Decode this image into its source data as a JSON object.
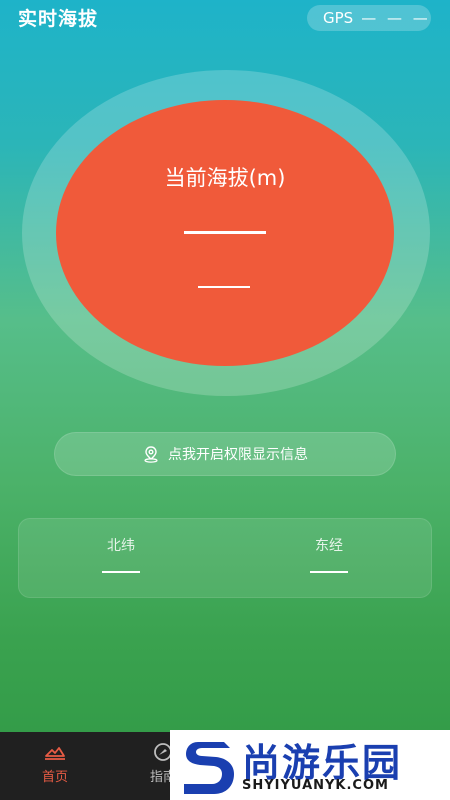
{
  "header": {
    "title": "实时海拔",
    "gps_label": "GPS",
    "gps_value": "— — —"
  },
  "altitude": {
    "label": "当前海拔(m)"
  },
  "permission": {
    "label": "点我开启权限显示信息",
    "icon": "location-pin-icon"
  },
  "coordinates": {
    "lat_label": "北纬",
    "lng_label": "东经"
  },
  "nav": {
    "items": [
      {
        "label": "首页",
        "icon": "home-icon",
        "active": true
      },
      {
        "label": "指南",
        "icon": "guide-icon",
        "active": false
      }
    ]
  },
  "watermark": {
    "cn": "尚游乐园",
    "en": "SHYIYUANYK.COM"
  },
  "colors": {
    "accent": "#f05a3a",
    "nav_active": "#e85c45",
    "nav_bg": "#202020",
    "watermark_blue": "#1a3fb0"
  }
}
